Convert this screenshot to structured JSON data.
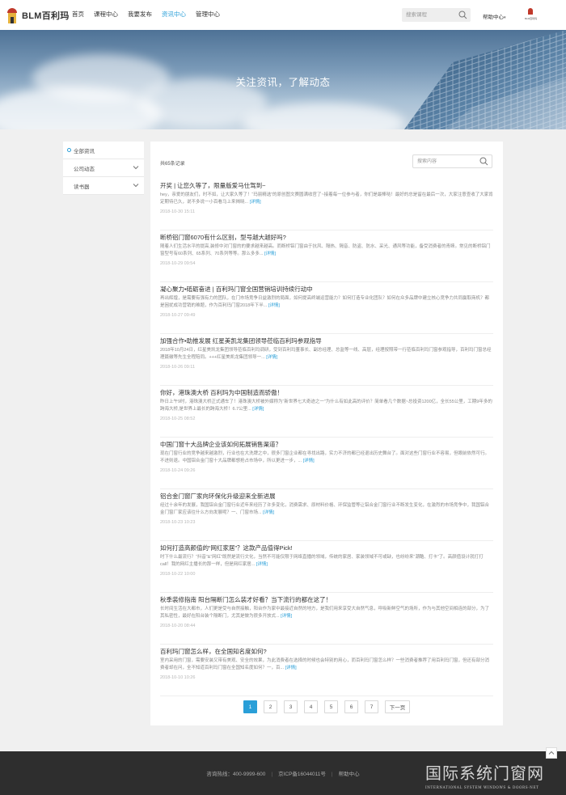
{
  "header": {
    "logo_text": "BLM百利玛",
    "nav": [
      {
        "label": "首页",
        "active": false
      },
      {
        "label": "课程中心",
        "active": false
      },
      {
        "label": "我要发布",
        "active": false
      },
      {
        "label": "资讯中心",
        "active": true
      },
      {
        "label": "管理中心",
        "active": false
      }
    ],
    "search_placeholder": "搜索课程",
    "help_label": "帮助中心",
    "avatar_label": "BLM百利玛"
  },
  "banner": {
    "title": "关注资讯，了解动态"
  },
  "sidebar": {
    "items": [
      {
        "label": "全部资讯",
        "active": true,
        "has_arrow": false
      },
      {
        "label": "公司动态",
        "active": false,
        "has_arrow": true
      },
      {
        "label": "读书器",
        "active": false,
        "has_arrow": true
      }
    ]
  },
  "main": {
    "count_text": "共65条记录",
    "search_placeholder": "搜索内容",
    "articles": [
      {
        "title": "开奖 | 让您久等了，限量版爱马仕驾到~",
        "summary": "hey，亲爱的朋友们，时不如，让大家久等了！“玛丽精选”的原创图文赛圆满收官了~接着每一位参与者，你们是最棒哒！最好的总是留在最后一次，大家注意查收了大家肯定期待已久，说不多说一小百看马上来揭晓...",
        "more": "[详情]",
        "date": "2018-10-30 15:11"
      },
      {
        "title": "断桥铝门窗6070有什么区别，型号越大越好吗?",
        "summary": "随着人们生活水平的提高,装修中对门窗的的要求越来越高。而断桥铝门窗由于抗风、隔热、隔音、防盗、防水、采光、通风等功能，备受消费者的青睐。常见的断桥铝门窗型号有60系列、65系列、70系列等等。那么多多...",
        "more": "[详情]",
        "date": "2018-10-29 09:54"
      },
      {
        "title": "凝心聚力•砥砺奋进 | 百利玛门窗全国营销培训持续行动中",
        "summary": "再出辉煌，是需要有强有力的团队，在门市场竞争日益激烈的局面，如何提高终端运营能力？如何打造专业化团队？如何在众多品牌中建立核心竞争力共同赢取商机？都是困扰成功营销的难题，作为百利玛门窗2018年下半...",
        "more": "[详情]",
        "date": "2018-10-27 09:49"
      },
      {
        "title": "加强合作•助推发展 红星美凯龙集团领导莅临百利玛参观指导",
        "summary": "2018年10月24日，红星美凯龙集团领导莅临百利玛调研，受到百利玛董事长、副总经理、总监等一线、高层，经理按照带一行莅临百利玛门窗参观指导，百利玛门窗总经理聂徽等先生全程陪同。+++红星美凯龙集团领导一...",
        "more": "[详情]",
        "date": "2018-10-26 09:11"
      },
      {
        "title": "你好，港珠澳大桥 百利玛为中国制造而骄傲！",
        "summary": "昨日上午9时，港珠澳大桥正式通车了！港珠澳大桥被外媒称为“新世界七大奇迹之一”为什么有如此高的评价？简单看几个数据~总投资1200亿，全长55公里，工期9年多的跨海大桥,是世界上最长的跨海大桥！6.7公里...",
        "more": "[详情]",
        "date": "2018-10-25 08:52"
      },
      {
        "title": "中国门窗十大品牌企业该如何拓展销售渠道？",
        "summary": "现在门窗行业的竞争越来越激烈，行业也在大洗牌之中，很多门窗企业都在寻找出路，实力不济的都已经退出历史舞台了。面对这些门窗行业不容易，但眼前依然可行。不进则退。中国铝合金门窗十大品牌都想抢占市场中，所以更进一步，...",
        "more": "[详情]",
        "date": "2018-10-24 09:26"
      },
      {
        "title": "铝合金门窗厂家向环保化升级迎来全新进展",
        "summary": "经过十余年的发展，我国铝合金门窗行业近年来经历了许多变化，消费需求、原材料价格、环保监管等让铝合金门窗行业不断发生变化，在激烈的市场竞争中，我国铝合金门窗厂家应该往什么方向发展呢？一、门窗市场...",
        "more": "[详情]",
        "date": "2018-10-23 10:23"
      },
      {
        "title": "如何打造高颜值的“网红家居”？这款产品值得Pick!",
        "summary": "时下什么最流行？“抖音”&“网红”既然是流行文化，当然不可能仅限于网络直播的领域，传统的家居、家装领域不可或缺，也纷纷来“潮酷、打卡”了。高颜值设计就打打call！我的网红主播长的那一样，但是网红家居...",
        "more": "[详情]",
        "date": "2018-10-22 10:00"
      },
      {
        "title": "秋季装修指南 阳台隔断门怎么装才好看？当下流行的都在这了！",
        "summary": "长时间生活在大都市，人们更是受与自然接触，阳台作为家中最接近自然的地方，是我们用来享受大自然气息，呼吸新鲜空气的场所，作为与其他空间相连的部分，为了其私密性，最好在阳台装个隔断门，尤其是做为很多开放式...",
        "more": "[详情]",
        "date": "2018-10-20 08:44"
      },
      {
        "title": "百利玛门窗怎么样，在全国知名度如何?",
        "summary": "室内采用的门窗，需要安装又带有美观、安全的效果，为此消费者在选择的时候也会特别的用心，而百利玛门窗怎么样？一些消费者推荐了用百利玛门窗，但还有部分消费者却在问，全不知道百利玛门窗在全国知名度如何？一，百...",
        "more": "[详情]",
        "date": "2018-10-10 10:26"
      }
    ],
    "pagination": {
      "pages": [
        "1",
        "2",
        "3",
        "4",
        "5",
        "6",
        "7"
      ],
      "active": "1",
      "next_label": "下一页"
    }
  },
  "footer": {
    "hotline": "咨询热线：400-9999-600",
    "icp": "京ICP备16044011号",
    "help": "帮助中心"
  },
  "watermark": {
    "title": "国际系统门窗网",
    "subtitle": "INTERNATIONAL SYSTEM WINDOWS & DOORS·NET"
  },
  "colors": {
    "accent": "#2a9fd8",
    "footer_bg": "#2e2e2e"
  }
}
